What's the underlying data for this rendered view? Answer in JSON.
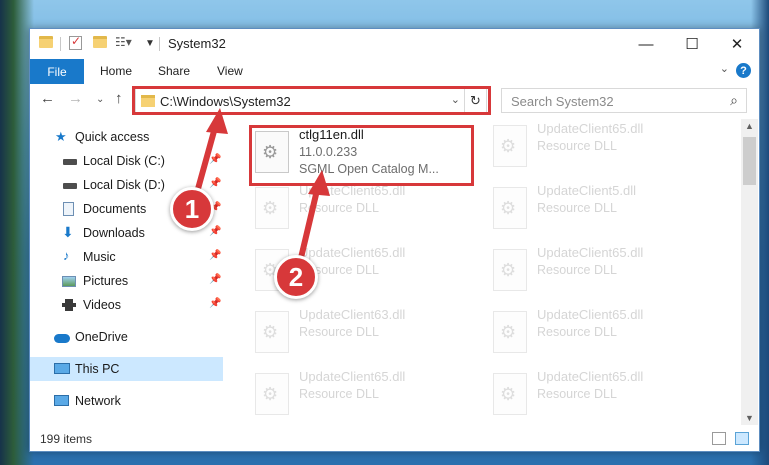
{
  "window": {
    "title": "System32",
    "minimize_glyph": "—",
    "maximize_glyph": "☐",
    "close_glyph": "✕"
  },
  "ribbon": {
    "file": "File",
    "home": "Home",
    "share": "Share",
    "view": "View",
    "help": "?"
  },
  "address": {
    "path": "C:\\Windows\\System32",
    "search_placeholder": "Search System32"
  },
  "navpane": {
    "items": [
      {
        "label": "Quick access",
        "icon": "star-icon",
        "pinned": false
      },
      {
        "label": "Local Disk (C:)",
        "icon": "drive-icon",
        "pinned": true
      },
      {
        "label": "Local Disk (D:)",
        "icon": "drive-icon",
        "pinned": true
      },
      {
        "label": "Documents",
        "icon": "documents-icon",
        "pinned": true
      },
      {
        "label": "Downloads",
        "icon": "download-icon",
        "pinned": true
      },
      {
        "label": "Music",
        "icon": "music-icon",
        "pinned": true
      },
      {
        "label": "Pictures",
        "icon": "pictures-icon",
        "pinned": true
      },
      {
        "label": "Videos",
        "icon": "video-icon",
        "pinned": true
      },
      {
        "label": "OneDrive",
        "icon": "cloud-icon",
        "pinned": false
      },
      {
        "label": "This PC",
        "icon": "computer-icon",
        "pinned": false,
        "selected": true
      },
      {
        "label": "Network",
        "icon": "network-icon",
        "pinned": false
      }
    ]
  },
  "files": {
    "highlighted": {
      "name": "ctlg11en.dll",
      "version": "11.0.0.233",
      "description": "SGML Open Catalog M..."
    },
    "col1": [
      {
        "name": "UpdateClient65.dll",
        "type": "Resource DLL"
      },
      {
        "name": "UpdateClient65.dll",
        "type": "Resource DLL"
      },
      {
        "name": "UpdateClient63.dll",
        "type": "Resource DLL"
      },
      {
        "name": "UpdateClient65.dll",
        "type": "Resource DLL"
      }
    ],
    "col2": [
      {
        "name": "UpdateClient65.dll",
        "type": "Resource DLL"
      },
      {
        "name": "UpdateClient5.dll",
        "type": "Resource DLL"
      },
      {
        "name": "UpdateClient65.dll",
        "type": "Resource DLL"
      },
      {
        "name": "UpdateClient65.dll",
        "type": "Resource DLL"
      },
      {
        "name": "UpdateClient65.dll",
        "type": "Resource DLL"
      }
    ]
  },
  "status": {
    "count": "199 items"
  },
  "annotations": {
    "step1": "1",
    "step2": "2",
    "color": "#d7383a"
  }
}
